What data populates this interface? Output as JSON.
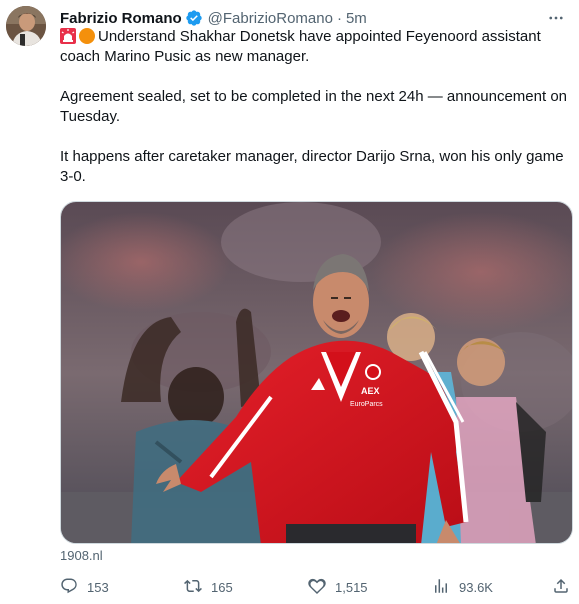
{
  "author": {
    "name": "Fabrizio Romano",
    "handle": "@FabrizioRomano",
    "separator": "·",
    "time": "5m"
  },
  "tweet": {
    "line1": "Understand Shakhar Donetsk have appointed Feyenoord assistant coach Marino Pusic as new manager.",
    "line2": "Agreement sealed, set to be completed in the next 24h — announcement on Tuesday.",
    "line3": "It happens after caretaker manager, director Darijo Srna, won his only game 3-0."
  },
  "media": {
    "jacket_text_top": "AEX",
    "jacket_text_bottom": "EuroParcs"
  },
  "link_source": "1908.nl",
  "actions": {
    "replies": "153",
    "retweets": "165",
    "likes": "1,515",
    "views": "93.6K"
  },
  "colors": {
    "accent": "#1d9bf0",
    "muted": "#536471",
    "text": "#0f1419",
    "jacket_red": "#d3101a"
  },
  "icons": [
    "verified-badge-icon",
    "siren-emoji-icon",
    "orange-circle-emoji-icon",
    "more-options-icon",
    "reply-icon",
    "retweet-icon",
    "like-icon",
    "views-icon",
    "share-icon"
  ]
}
